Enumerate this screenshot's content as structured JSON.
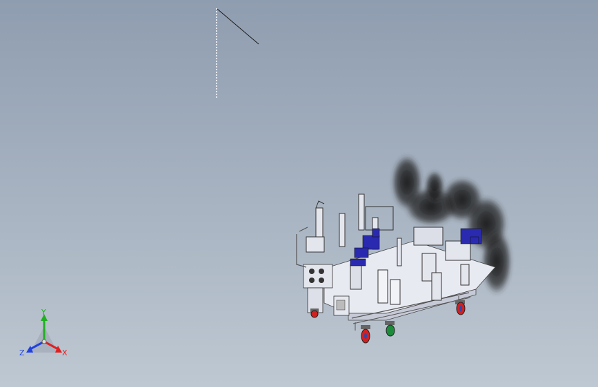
{
  "viewport": {
    "background_top": "#8f9db0",
    "background_bottom": "#bec8d2"
  },
  "triad": {
    "x_label": "X",
    "y_label": "Y",
    "z_label": "Z",
    "x_color": "#e02020",
    "y_color": "#20b020",
    "z_color": "#2040e0"
  },
  "model": {
    "frame_color": "#eceef6",
    "clamp_color": "#2a2ab0",
    "wheel_color": "#d02020",
    "smoke_color": "#1e1e1e"
  }
}
